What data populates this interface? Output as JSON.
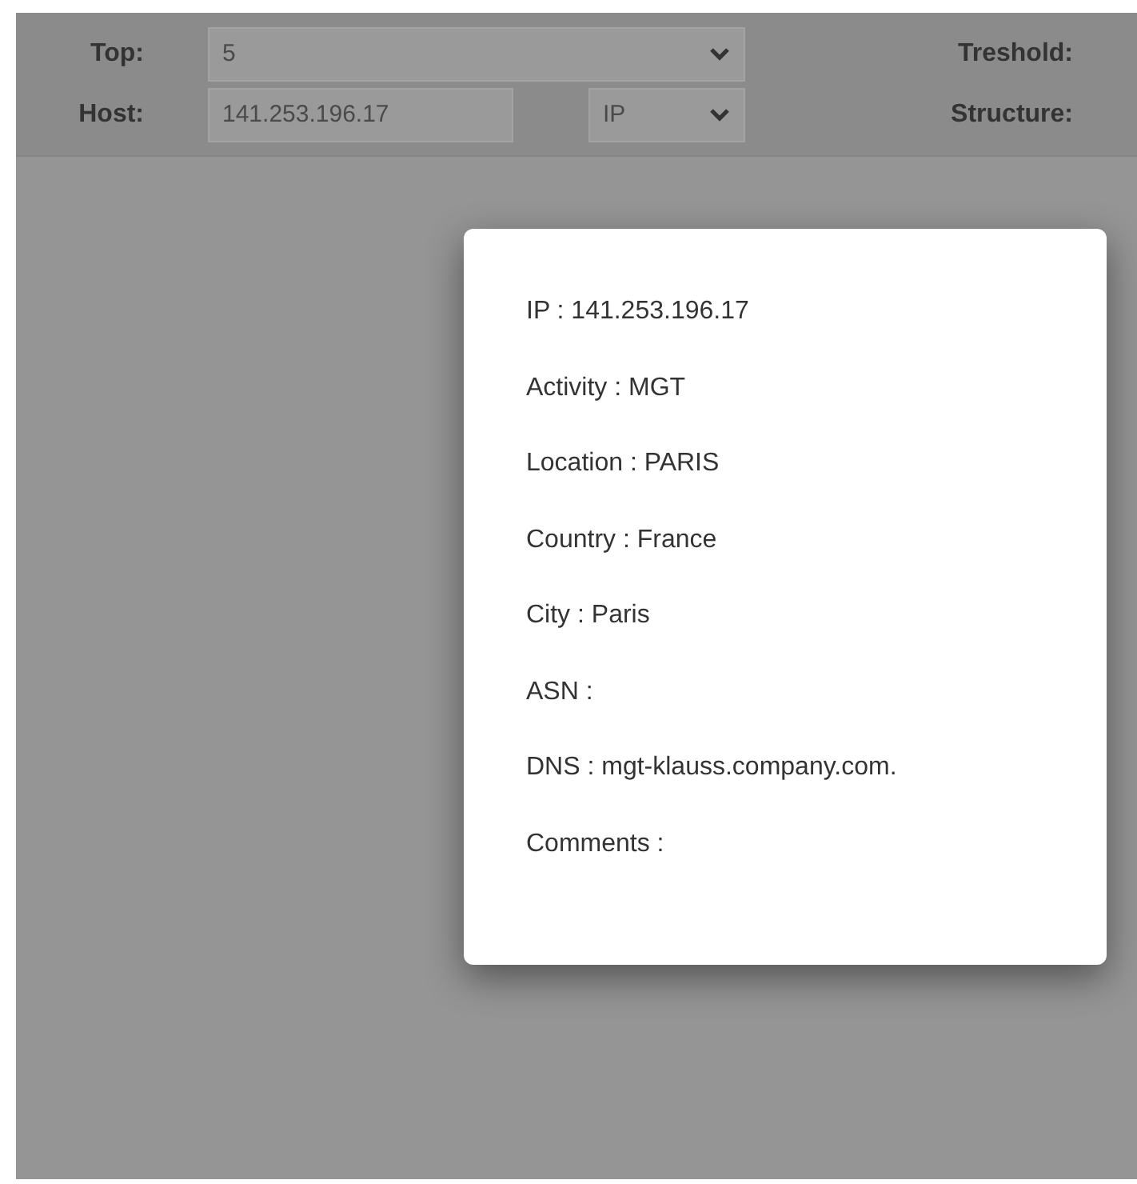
{
  "toolbar": {
    "rows": [
      {
        "label": "Top:",
        "select": {
          "value": "5"
        },
        "right_label": "Treshold:"
      },
      {
        "label": "Host:",
        "input": {
          "value": "141.253.196.17"
        },
        "select": {
          "value": "IP"
        },
        "right_label": "Structure:"
      }
    ]
  },
  "popup": {
    "lines": [
      "IP : 141.253.196.17",
      "Activity : MGT",
      "Location : PARIS",
      "Country : France",
      "City : Paris",
      "ASN :",
      "DNS : mgt-klauss.company.com.",
      "Comments :"
    ]
  }
}
